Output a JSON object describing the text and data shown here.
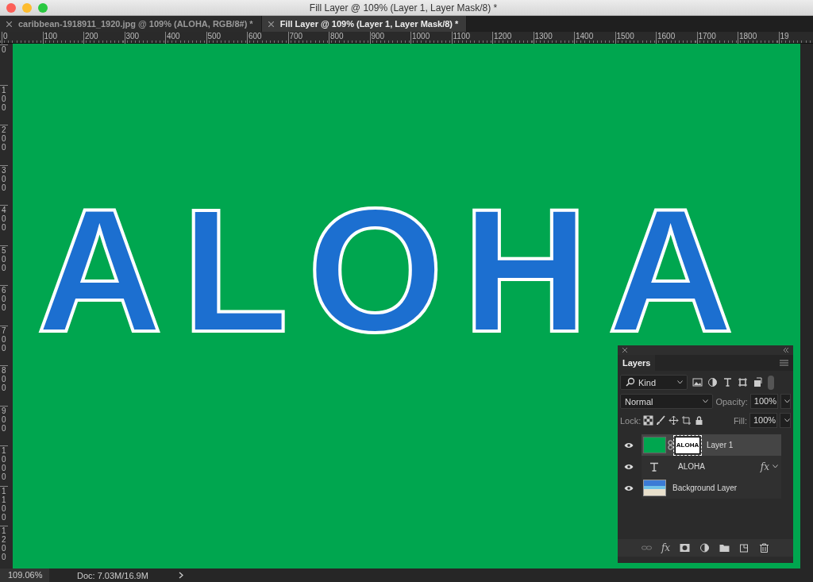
{
  "window": {
    "title": "Fill Layer @ 109% (Layer 1, Layer Mask/8) *"
  },
  "tabs": [
    {
      "label": "caribbean-1918911_1920.jpg @ 109% (ALOHA, RGB/8#) *",
      "selected": false
    },
    {
      "label": "Fill Layer @ 109% (Layer 1, Layer Mask/8) *",
      "selected": true
    }
  ],
  "rulers": {
    "horizontal": [
      "0",
      "100",
      "200",
      "300",
      "400",
      "500",
      "600",
      "700",
      "800",
      "900",
      "1000",
      "1100",
      "1200",
      "1300",
      "1400",
      "1500",
      "1600",
      "1700",
      "1800",
      "19"
    ],
    "vertical": [
      "0",
      "100",
      "200",
      "300",
      "400",
      "500",
      "600",
      "700",
      "800",
      "900",
      "1000",
      "1100",
      "1200"
    ]
  },
  "canvas": {
    "artwork_text": "ALOHA"
  },
  "layers_panel": {
    "title": "Layers",
    "filter": "Kind",
    "blend_mode": "Normal",
    "opacity_label": "Opacity:",
    "opacity": "100%",
    "lock_label": "Lock:",
    "fill_label": "Fill:",
    "fill": "100%",
    "layers": [
      {
        "kind": "fill",
        "name": "Layer 1",
        "mask_text": "ALOHA",
        "visible": true,
        "selected": true
      },
      {
        "kind": "text",
        "name": "ALOHA",
        "effects": "fx",
        "visible": true,
        "selected": false
      },
      {
        "kind": "image",
        "name": "Background Layer",
        "visible": true,
        "selected": false
      }
    ],
    "footer_fx": "fx"
  },
  "status_bar": {
    "zoom": "109.06%",
    "doc": "Doc: 7.03M/16.9M"
  }
}
